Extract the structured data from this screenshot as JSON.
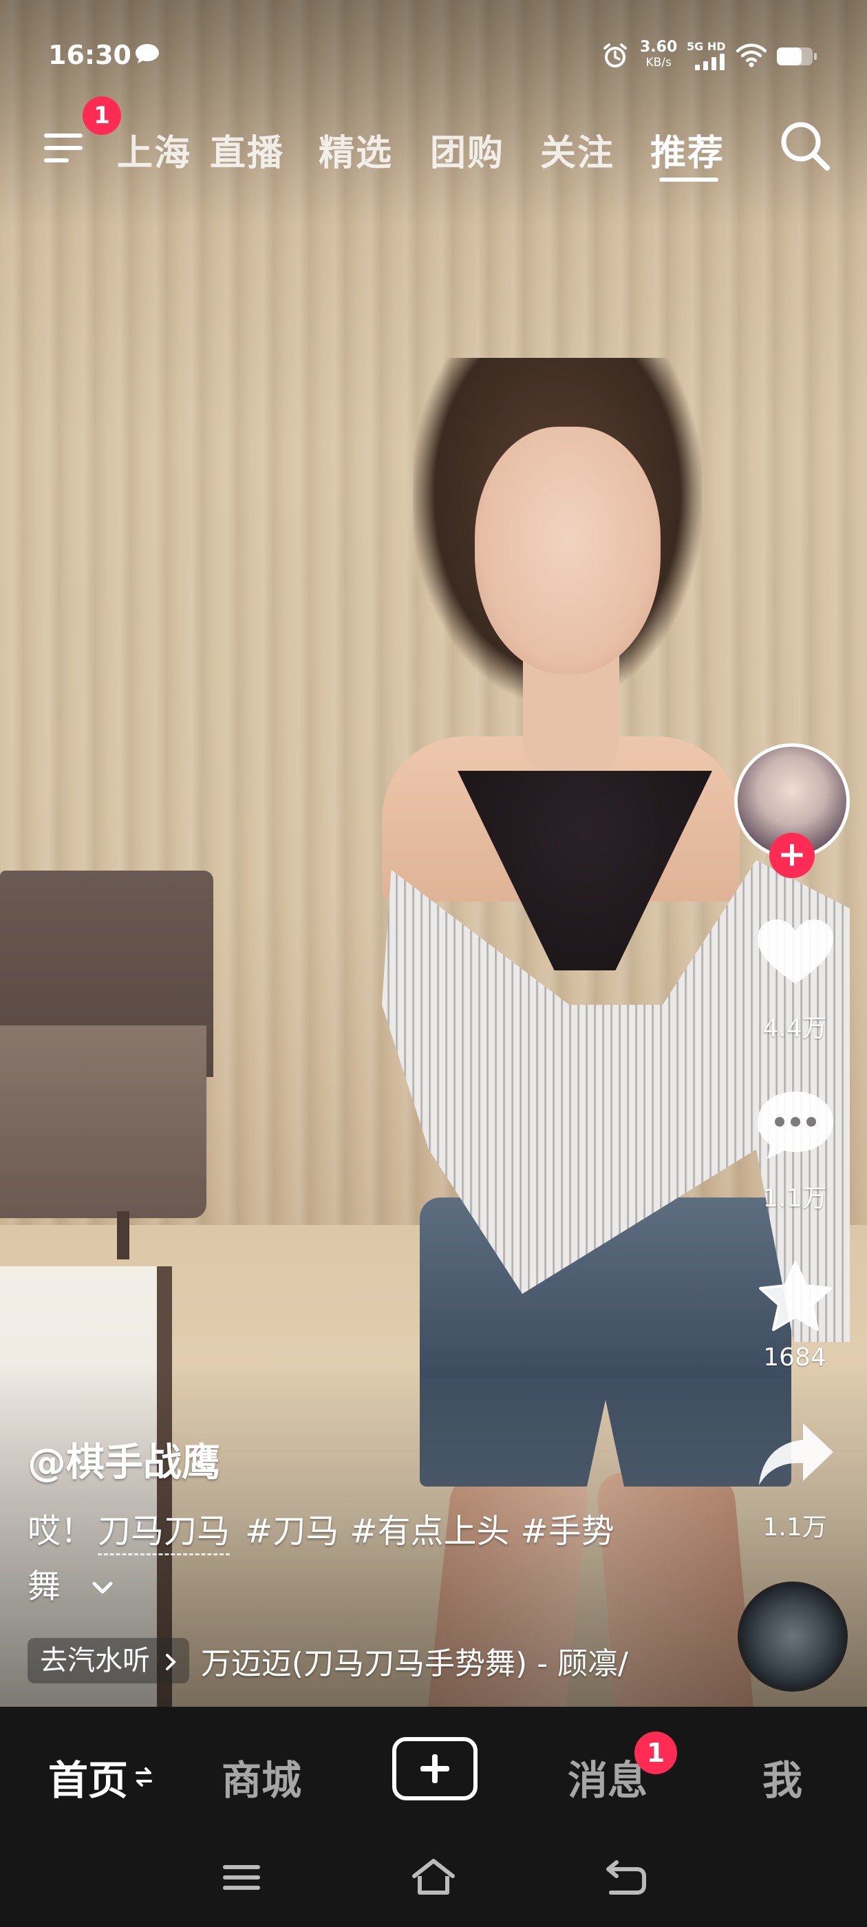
{
  "status_bar": {
    "time": "16:30",
    "speed_value": "3.60",
    "speed_unit": "KB/s",
    "network": "5G HD",
    "icons": [
      "chat-bubble-icon",
      "alarm-icon",
      "signal-icon",
      "wifi-icon",
      "battery-icon"
    ]
  },
  "top_nav": {
    "menu_badge": "1",
    "tabs": [
      {
        "label": "上海",
        "active": false
      },
      {
        "label": "直播",
        "active": false
      },
      {
        "label": "精选",
        "active": false
      },
      {
        "label": "团购",
        "active": false
      },
      {
        "label": "关注",
        "active": false
      },
      {
        "label": "推荐",
        "active": true
      }
    ],
    "icons": [
      "menu-icon",
      "search-icon"
    ]
  },
  "right_rail": {
    "like_count": "4.4万",
    "comment_count": "1.1万",
    "favorite_count": "1684",
    "share_count": "1.1万",
    "follow_symbol": "+"
  },
  "caption": {
    "author": "@棋手战鹰",
    "prefix": "哎！",
    "link_text": "刀马刀马",
    "tags": [
      "#刀马",
      "#有点上头",
      "#手势"
    ],
    "continuation": "舞"
  },
  "music": {
    "chip_label": "去汽水听",
    "title": "万迈迈(刀马刀马手势舞) - 顾凛/"
  },
  "bottom_tabs": {
    "home": "首页",
    "mall": "商城",
    "messages": "消息",
    "messages_badge": "1",
    "me": "我"
  },
  "colors": {
    "accent": "#fe2c55",
    "bar_background": "#161616"
  }
}
